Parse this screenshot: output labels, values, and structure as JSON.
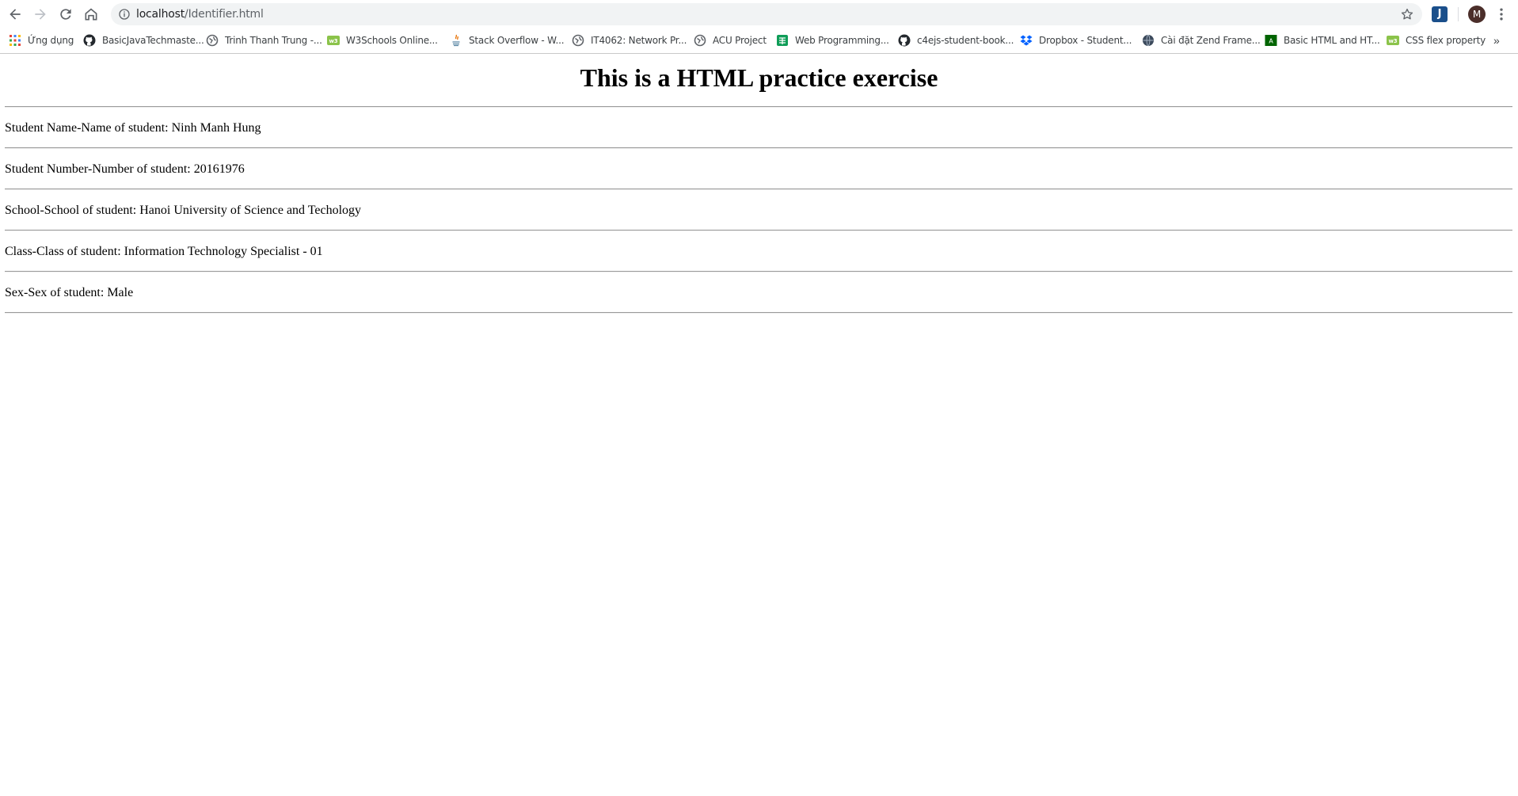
{
  "browser": {
    "url_host": "localhost",
    "url_path": "/Identifier.html",
    "extension_letter": "J",
    "profile_initial": "M",
    "icons": [
      "back-icon",
      "forward-icon",
      "reload-icon",
      "home-icon",
      "info-icon",
      "star-icon",
      "more-icon"
    ]
  },
  "bookmarks": [
    {
      "label": "Ứng dụng",
      "icon": "apps-grid-icon"
    },
    {
      "label": "BasicJavaTechmaste...",
      "icon": "github-icon"
    },
    {
      "label": "Trinh Thanh Trung -...",
      "icon": "globe-icon"
    },
    {
      "label": "W3Schools Online...",
      "icon": "w3schools-icon"
    },
    {
      "label": "Stack Overflow - W...",
      "icon": "java-icon"
    },
    {
      "label": "IT4062: Network Pr...",
      "icon": "globe-icon"
    },
    {
      "label": "ACU Project",
      "icon": "globe-icon"
    },
    {
      "label": "Web Programming...",
      "icon": "sheets-icon"
    },
    {
      "label": "c4ejs-student-book...",
      "icon": "github-icon"
    },
    {
      "label": "Dropbox - Student...",
      "icon": "dropbox-icon"
    },
    {
      "label": "Cài đặt Zend Frame...",
      "icon": "globe-dark-icon"
    },
    {
      "label": "Basic HTML and HT...",
      "icon": "fcc-icon"
    },
    {
      "label": "CSS flex property",
      "icon": "w3schools-icon"
    }
  ],
  "bookmarks_overflow": "»",
  "page": {
    "heading": "This is a HTML practice exercise",
    "lines": [
      "Student Name-Name of student: Ninh Manh Hung",
      "Student Number-Number of student: 20161976",
      "School-School of student: Hanoi University of Science and Techology",
      "Class-Class of student: Information Technology Specialist - 01",
      "Sex-Sex of student: Male"
    ]
  },
  "colors": {
    "omnibox_bg": "#f1f3f4",
    "avatar_bg": "#4b2e2a",
    "rule": "#9a9a9a"
  }
}
